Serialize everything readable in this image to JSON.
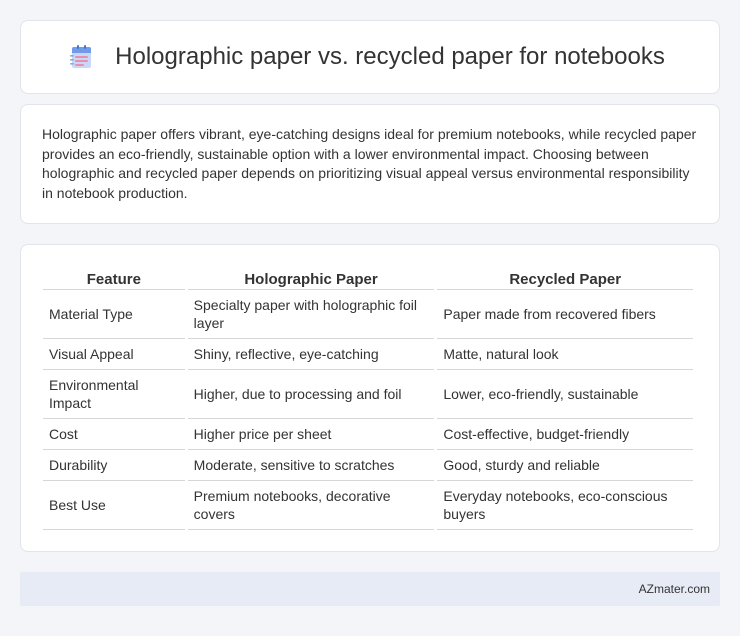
{
  "header": {
    "title": "Holographic paper vs. recycled paper for notebooks",
    "icon": "notebook-icon"
  },
  "summary": {
    "text": "Holographic paper offers vibrant, eye-catching designs ideal for premium notebooks, while recycled paper provides an eco-friendly, sustainable option with a lower environmental impact. Choosing between holographic and recycled paper depends on prioritizing visual appeal versus environmental responsibility in notebook production."
  },
  "table": {
    "headers": [
      "Feature",
      "Holographic Paper",
      "Recycled Paper"
    ],
    "rows": [
      [
        "Material Type",
        "Specialty paper with holographic foil layer",
        "Paper made from recovered fibers"
      ],
      [
        "Visual Appeal",
        "Shiny, reflective, eye-catching",
        "Matte, natural look"
      ],
      [
        "Environmental Impact",
        "Higher, due to processing and foil",
        "Lower, eco-friendly, sustainable"
      ],
      [
        "Cost",
        "Higher price per sheet",
        "Cost-effective, budget-friendly"
      ],
      [
        "Durability",
        "Moderate, sensitive to scratches",
        "Good, sturdy and reliable"
      ],
      [
        "Best Use",
        "Premium notebooks, decorative covers",
        "Everyday notebooks, eco-conscious buyers"
      ]
    ]
  },
  "footer": {
    "text": "AZmater.com"
  },
  "colors": {
    "background": "#f3f5f8",
    "card": "#ffffff",
    "footer": "#e6ebf5",
    "text": "#333333"
  }
}
